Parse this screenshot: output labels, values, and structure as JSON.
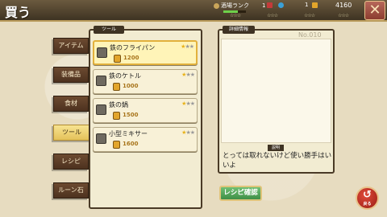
{
  "header": {
    "title": "買う",
    "rank_label": "酒場ランク",
    "rank_value": "1",
    "rank_progress": 0.65,
    "gem_value": "1",
    "money_value": "4160",
    "status_stars": [
      "☆☆☆",
      "☆☆☆",
      "☆☆☆",
      "☆☆☆"
    ]
  },
  "tabs": [
    {
      "label": "アイテム"
    },
    {
      "label": "装備品"
    },
    {
      "label": "食材"
    },
    {
      "label": "ツール"
    },
    {
      "label": "レシピ"
    },
    {
      "label": "ルーン石"
    }
  ],
  "tool_panel": {
    "label": "ツール",
    "items": [
      {
        "name": "鉄のフライパン",
        "price": "1200",
        "stars_on": "★",
        "stars_off": "★★"
      },
      {
        "name": "鉄のケトル",
        "price": "1000",
        "stars_on": "★",
        "stars_off": "★★"
      },
      {
        "name": "鉄の鍋",
        "price": "1500",
        "stars_on": "★",
        "stars_off": "★★"
      },
      {
        "name": "小型ミキサー",
        "price": "1600",
        "stars_on": "★",
        "stars_off": "★★"
      }
    ]
  },
  "detail": {
    "label": "詳細情報",
    "number": "No.010",
    "desc_label": "説明",
    "description": "とっては取れないけど使い勝手はいいよ"
  },
  "buttons": {
    "recipe": "レシピ確認",
    "back_label": "戻る",
    "close": "✕",
    "back_icon": "↺"
  },
  "colors": {
    "accent": "#e2b13c",
    "tab_bg": "#5c3e27",
    "tab_active": "#f0d36e",
    "recipe_button": "#4fa356",
    "back_button": "#c8301f"
  }
}
